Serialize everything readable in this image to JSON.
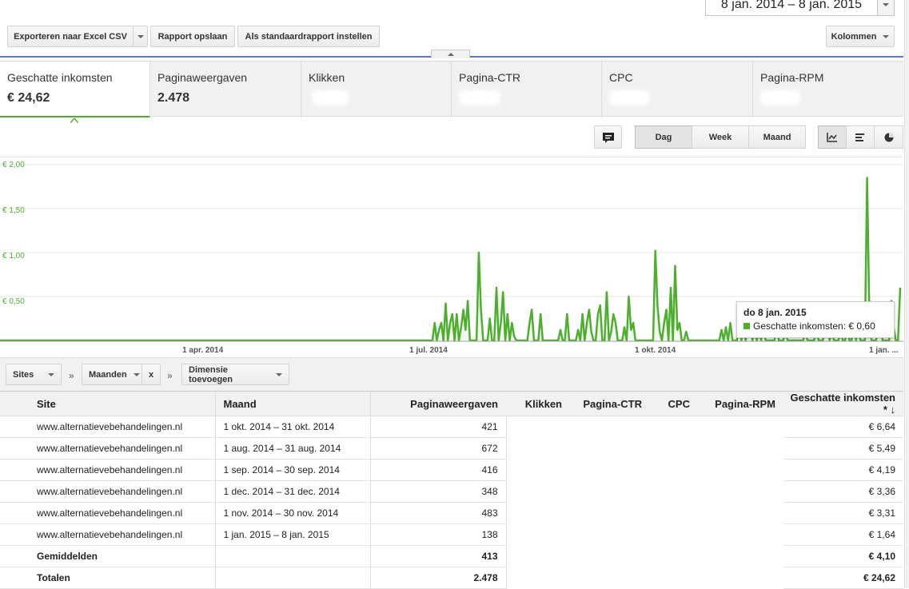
{
  "toolbar": {
    "export_label": "Exporteren naar Excel CSV",
    "save_label": "Rapport opslaan",
    "default_label": "Als standaardrapport instellen",
    "columns_label": "Kolommen",
    "date_range": "8 jan. 2014 – 8 jan. 2015"
  },
  "metrics": [
    {
      "label": "Geschatte inkomsten",
      "value": "€ 24,62"
    },
    {
      "label": "Paginaweergaven",
      "value": "2.478"
    },
    {
      "label": "Klikken",
      "value": ""
    },
    {
      "label": "Pagina-CTR",
      "value": ""
    },
    {
      "label": "CPC",
      "value": ""
    },
    {
      "label": "Pagina-RPM",
      "value": ""
    }
  ],
  "granularity": {
    "day": "Dag",
    "week": "Week",
    "month": "Maand",
    "selected": "Dag"
  },
  "icons": {
    "annotation": "comment-icon",
    "line": "line-chart-icon",
    "bar": "bar-chart-icon",
    "pie": "pie-chart-icon"
  },
  "colors": {
    "accent": "#4eaf2f"
  },
  "chart_data": {
    "type": "line",
    "title": "",
    "series": [
      {
        "name": "Geschatte inkomsten",
        "values": [
          0,
          0,
          0,
          0,
          0,
          0,
          0,
          0,
          0,
          0,
          0,
          0,
          0,
          0,
          0,
          0,
          0,
          0,
          0,
          0,
          0,
          0,
          0,
          0,
          0,
          0,
          0,
          0,
          0,
          0,
          0,
          0,
          0,
          0,
          0,
          0,
          0,
          0,
          0,
          0,
          0,
          0,
          0,
          0,
          0,
          0,
          0,
          0,
          0,
          0,
          0,
          0,
          0,
          0,
          0,
          0,
          0,
          0,
          0,
          0,
          0,
          0,
          0,
          0,
          0,
          0,
          0,
          0,
          0,
          0,
          0,
          0,
          0,
          0,
          0,
          0,
          0,
          0,
          0,
          0,
          0,
          0,
          0,
          0,
          0,
          0,
          0,
          0,
          0,
          0,
          0,
          0,
          0,
          0,
          0,
          0,
          0,
          0,
          0,
          0,
          0,
          0,
          0,
          0,
          0,
          0,
          0,
          0,
          0,
          0,
          0,
          0,
          0,
          0,
          0,
          0,
          0,
          0,
          0,
          0,
          0,
          0,
          0,
          0,
          0,
          0,
          0,
          0,
          0,
          0,
          0,
          0,
          0,
          0,
          0,
          0,
          0,
          0,
          0,
          0,
          0,
          0,
          0,
          0,
          0,
          0,
          0,
          0,
          0,
          0,
          0,
          0,
          0,
          0,
          0,
          0,
          0,
          0,
          0,
          0,
          0,
          0,
          0,
          0,
          0,
          0,
          0,
          0,
          0,
          0,
          0,
          0,
          0,
          0,
          0,
          0,
          0,
          0,
          0,
          0,
          0,
          0,
          0,
          0,
          0,
          0,
          0,
          0,
          0,
          0,
          0,
          0,
          0,
          0,
          0,
          0,
          0,
          0.2,
          0,
          0.12,
          0.2,
          0,
          0.42,
          0,
          0.2,
          0.3,
          0,
          0.3,
          0,
          0.15,
          0.35,
          0.12,
          0.45,
          0,
          0,
          0,
          0,
          1.0,
          0.35,
          0,
          0,
          0,
          0.25,
          0,
          0,
          0.6,
          0,
          0.2,
          0.55,
          0,
          0.3,
          0,
          0.2,
          0.05,
          0,
          0,
          0,
          0,
          0,
          0,
          0.2,
          0.35,
          0,
          0,
          0,
          0.3,
          0,
          0,
          0,
          0,
          0,
          0,
          0,
          0,
          0.12,
          0,
          0,
          0.3,
          0,
          0,
          0,
          0,
          0.12,
          0,
          0.3,
          0,
          0.2,
          0.35,
          0.1,
          0,
          0,
          0.3,
          0.4,
          0,
          0,
          0.55,
          0,
          0.1,
          0.3,
          0.2,
          0,
          0,
          0,
          0.15,
          0,
          0.5,
          0.12,
          0.2,
          0,
          0,
          0,
          0,
          0,
          0,
          0,
          0,
          0,
          1.02,
          0.4,
          0.1,
          0,
          0.2,
          0.35,
          0,
          0.6,
          0,
          0.85,
          0.12,
          0.2,
          0,
          0,
          0.1,
          0,
          0,
          0,
          0,
          0,
          0,
          0,
          0,
          0,
          0,
          0,
          0,
          0,
          0,
          0,
          0.12,
          0,
          0.15,
          0,
          0.2,
          0,
          0,
          0,
          0.35,
          0,
          0.1,
          0,
          0.35,
          0.42,
          0,
          0.1,
          0,
          0.12,
          0,
          0.2,
          0,
          0,
          0,
          0,
          0,
          0.2,
          0,
          0,
          0,
          0.1,
          0,
          0,
          0,
          0,
          0,
          0,
          0,
          0,
          0.1,
          0,
          0,
          0,
          0,
          0.12,
          0,
          0,
          0,
          0.3,
          0.2,
          0,
          0.1,
          0,
          0,
          0,
          0.1,
          0,
          0,
          0.15,
          0,
          0,
          0.42,
          0,
          0.2,
          0,
          0,
          0,
          1.85,
          0.3,
          0,
          0,
          0,
          0.1,
          0.2,
          0,
          0,
          0,
          0,
          0.45,
          0.15,
          0,
          0,
          0.6
        ]
      }
    ],
    "ylim": [
      0,
      2.0
    ],
    "yticks": [
      "€ 2,00",
      "€ 1,50",
      "€ 1,00",
      "€ 0,50"
    ],
    "xticks": [
      "1 apr. 2014",
      "1 jul. 2014",
      "1 okt. 2014",
      "1 jan. ..."
    ],
    "grid": true,
    "tooltip": {
      "date": "do 8 jan. 2015",
      "label": "Geschatte inkomsten: € 0,60"
    }
  },
  "filters": {
    "dim1": "Sites",
    "dim2": "Maanden",
    "remove": "x",
    "add": "Dimensie toevoegen",
    "arrow": "»"
  },
  "table": {
    "headers": {
      "site": "Site",
      "month": "Maand",
      "pageviews": "Paginaweergaven",
      "clicks": "Klikken",
      "ctr": "Pagina-CTR",
      "cpc": "CPC",
      "rpm": "Pagina-RPM",
      "revenue": "Geschatte inkomsten * ↓"
    },
    "rows": [
      {
        "site": "www.alternatievebehandelingen.nl",
        "month": "1 okt. 2014 – 31 okt. 2014",
        "pv": "421",
        "rev": "€ 6,64"
      },
      {
        "site": "www.alternatievebehandelingen.nl",
        "month": "1 aug. 2014 – 31 aug. 2014",
        "pv": "672",
        "rev": "€ 5,49"
      },
      {
        "site": "www.alternatievebehandelingen.nl",
        "month": "1 sep. 2014 – 30 sep. 2014",
        "pv": "416",
        "rev": "€ 4,19"
      },
      {
        "site": "www.alternatievebehandelingen.nl",
        "month": "1 dec. 2014 – 31 dec. 2014",
        "pv": "348",
        "rev": "€ 3,36"
      },
      {
        "site": "www.alternatievebehandelingen.nl",
        "month": "1 nov. 2014 – 30 nov. 2014",
        "pv": "483",
        "rev": "€ 3,31"
      },
      {
        "site": "www.alternatievebehandelingen.nl",
        "month": "1 jan. 2015 – 8 jan. 2015",
        "pv": "138",
        "rev": "€ 1,64"
      }
    ],
    "avg": {
      "label": "Gemiddelden",
      "pv": "413",
      "rev": "€ 4,10"
    },
    "total": {
      "label": "Totalen",
      "pv": "2.478",
      "rev": "€ 24,62"
    }
  }
}
